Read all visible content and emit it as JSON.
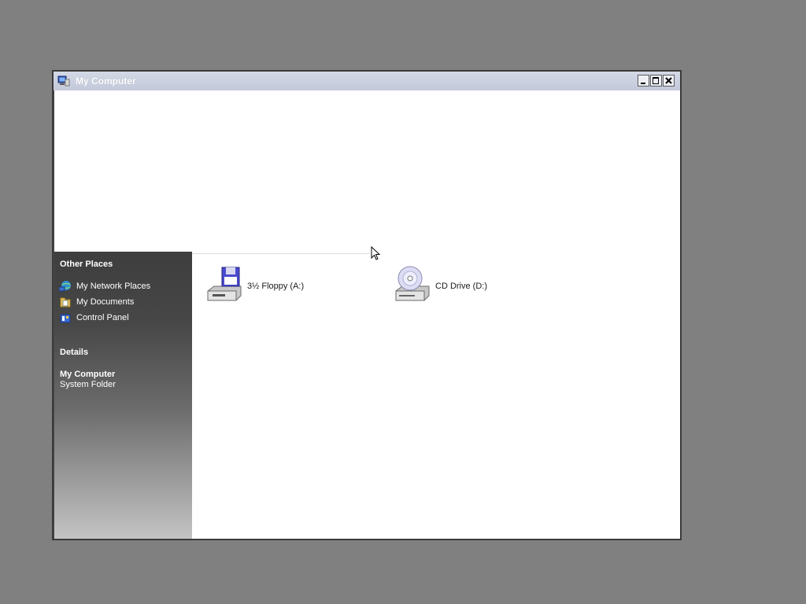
{
  "window": {
    "title": "My Computer"
  },
  "sidebar": {
    "other_places": {
      "heading": "Other Places",
      "items": [
        {
          "label": "My Network Places",
          "icon": "network-places-icon"
        },
        {
          "label": "My Documents",
          "icon": "documents-folder-icon"
        },
        {
          "label": "Control Panel",
          "icon": "control-panel-icon"
        }
      ]
    },
    "details": {
      "heading": "Details",
      "name": "My Computer",
      "type": "System Folder"
    }
  },
  "drives": [
    {
      "label": "3½ Floppy (A:)",
      "icon": "floppy-drive-icon"
    },
    {
      "label": "CD Drive (D:)",
      "icon": "cd-drive-icon"
    }
  ],
  "colors": {
    "desktop": "#808080",
    "titlebar": "#c8cedd",
    "sidebar_top": "#3e3e3e",
    "sidebar_bottom": "#c4c4c4",
    "content": "#ffffff"
  }
}
